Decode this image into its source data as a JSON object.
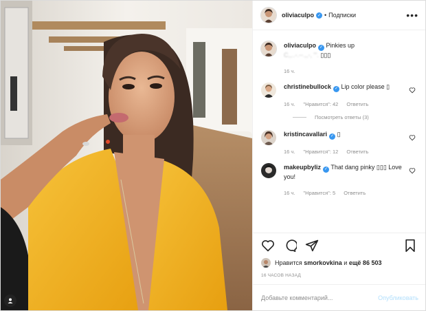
{
  "post": {
    "username": "oliviaculpo",
    "separator": "•",
    "follow_status": "Подписки",
    "more_icon": "more-horizontal-icon"
  },
  "comments": [
    {
      "username": "oliviaculpo",
      "text": "Pinkies up",
      "text_blur": "C,,..-.--.,,-, \"'.",
      "emoji": "▯▯▯",
      "time": "16 ч."
    },
    {
      "username": "christinebullock",
      "text": "Lip color please ▯",
      "time": "16 ч.",
      "likes": "\"Нравится\": 42",
      "reply": "Ответить",
      "view_replies": "Посмотреть ответы (3)"
    },
    {
      "username": "kristincavallari",
      "text": "▯",
      "time": "16 ч.",
      "likes": "\"Нравится\": 12",
      "reply": "Ответить"
    },
    {
      "username": "makeupbyliz",
      "text": "That dang pinky ▯▯▯ Love you!",
      "time": "16 ч.",
      "likes": "\"Нравится\": 5",
      "reply": "Ответить"
    }
  ],
  "likes": {
    "prefix": "Нравится",
    "user": "smorkovkina",
    "and": "и",
    "count": "ещё 86 503"
  },
  "timestamp": "16 ЧАСОВ НАЗАД",
  "add_comment": {
    "placeholder": "Добавьте комментарий...",
    "publish": "Опубликовать"
  },
  "colors": {
    "accent": "#3897f0",
    "muted": "#8e8e8e",
    "publish_disabled": "#b2dffc",
    "shirt": "#f2b320"
  }
}
